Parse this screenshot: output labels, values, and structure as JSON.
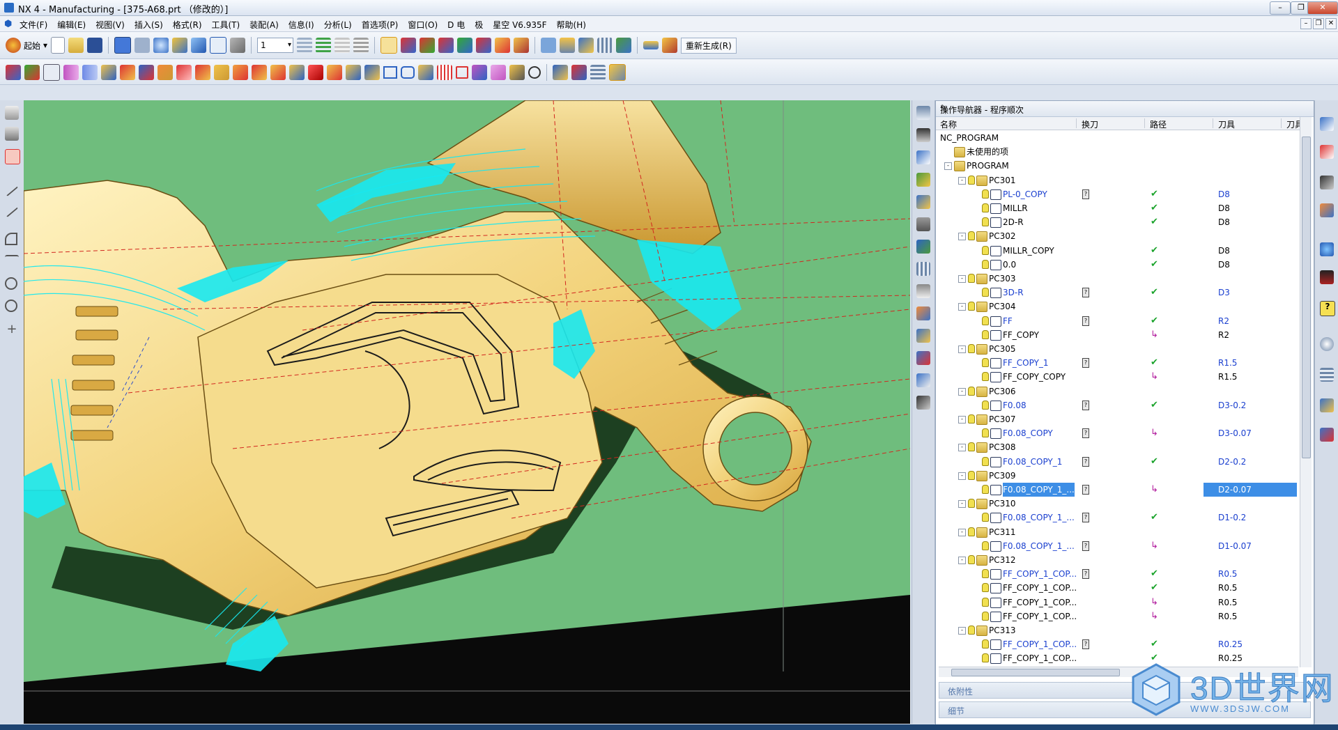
{
  "window": {
    "title": "NX 4 - Manufacturing - [375-A68.prt （修改的）]",
    "controls": {
      "minimize": "–",
      "restore": "❐",
      "close": "✕"
    }
  },
  "menubar": {
    "items": [
      "文件(F)",
      "编辑(E)",
      "视图(V)",
      "插入(S)",
      "格式(R)",
      "工具(T)",
      "装配(A)",
      "信息(I)",
      "分析(L)",
      "首选项(P)",
      "窗口(O)",
      "D 电",
      "极",
      "星空 V6.935F",
      "帮助(H)"
    ]
  },
  "toolbar": {
    "start_label": "起始",
    "layer_value": "1",
    "regen_label": "重新生成(R)"
  },
  "navigator": {
    "title": "操作导航器 - 程序顺次",
    "columns": [
      "名称",
      "换刀",
      "路径",
      "刀具",
      "刀具"
    ],
    "rows": [
      {
        "level": 0,
        "name": "NC_PROGRAM",
        "kind": "root"
      },
      {
        "level": 1,
        "name": "未使用的项",
        "kind": "folder"
      },
      {
        "level": 1,
        "name": "PROGRAM",
        "kind": "folder",
        "expand": "-"
      },
      {
        "level": 2,
        "name": "PC301",
        "kind": "folder",
        "expand": "-"
      },
      {
        "level": 3,
        "name": "PL-0_COPY",
        "kind": "op",
        "blue": true,
        "tc": true,
        "path": "ok",
        "tool": "D8",
        "toolBlue": true
      },
      {
        "level": 3,
        "name": "MILLR",
        "kind": "op",
        "path": "ok",
        "tool": "D8"
      },
      {
        "level": 3,
        "name": "2D-R",
        "kind": "op",
        "path": "ok",
        "tool": "D8"
      },
      {
        "level": 2,
        "name": "PC302",
        "kind": "folder",
        "expand": "-"
      },
      {
        "level": 3,
        "name": "MILLR_COPY",
        "kind": "op",
        "path": "ok",
        "tool": "D8"
      },
      {
        "level": 3,
        "name": "0.0",
        "kind": "op",
        "path": "ok",
        "tool": "D8"
      },
      {
        "level": 2,
        "name": "PC303",
        "kind": "folder",
        "expand": "-"
      },
      {
        "level": 3,
        "name": "3D-R",
        "kind": "op",
        "blue": true,
        "tc": true,
        "path": "ok",
        "tool": "D3",
        "toolBlue": true
      },
      {
        "level": 2,
        "name": "PC304",
        "kind": "folder",
        "expand": "-"
      },
      {
        "level": 3,
        "name": "FF",
        "kind": "op",
        "blue": true,
        "tc": true,
        "path": "ok",
        "tool": "R2",
        "toolBlue": true
      },
      {
        "level": 3,
        "name": "FF_COPY",
        "kind": "op",
        "path": "rep",
        "tool": "R2"
      },
      {
        "level": 2,
        "name": "PC305",
        "kind": "folder",
        "expand": "-"
      },
      {
        "level": 3,
        "name": "FF_COPY_1",
        "kind": "op",
        "blue": true,
        "tc": true,
        "path": "ok",
        "tool": "R1.5",
        "toolBlue": true
      },
      {
        "level": 3,
        "name": "FF_COPY_COPY",
        "kind": "op",
        "path": "rep",
        "tool": "R1.5"
      },
      {
        "level": 2,
        "name": "PC306",
        "kind": "folder",
        "expand": "-"
      },
      {
        "level": 3,
        "name": "F0.08",
        "kind": "op",
        "blue": true,
        "tc": true,
        "path": "ok",
        "tool": "D3-0.2",
        "toolBlue": true
      },
      {
        "level": 2,
        "name": "PC307",
        "kind": "folder",
        "expand": "-"
      },
      {
        "level": 3,
        "name": "F0.08_COPY",
        "kind": "op",
        "blue": true,
        "tc": true,
        "path": "rep",
        "tool": "D3-0.07",
        "toolBlue": true
      },
      {
        "level": 2,
        "name": "PC308",
        "kind": "folder",
        "expand": "-"
      },
      {
        "level": 3,
        "name": "F0.08_COPY_1",
        "kind": "op",
        "blue": true,
        "tc": true,
        "path": "ok",
        "tool": "D2-0.2",
        "toolBlue": true
      },
      {
        "level": 2,
        "name": "PC309",
        "kind": "folder",
        "expand": "-"
      },
      {
        "level": 3,
        "name": "F0.08_COPY_1_...",
        "kind": "op",
        "blue": true,
        "tc": true,
        "path": "rep",
        "tool": "D2-0.07",
        "selected": true
      },
      {
        "level": 2,
        "name": "PC310",
        "kind": "folder",
        "expand": "-"
      },
      {
        "level": 3,
        "name": "F0.08_COPY_1_...",
        "kind": "op",
        "blue": true,
        "tc": true,
        "path": "ok",
        "tool": "D1-0.2",
        "toolBlue": true
      },
      {
        "level": 2,
        "name": "PC311",
        "kind": "folder",
        "expand": "-"
      },
      {
        "level": 3,
        "name": "F0.08_COPY_1_...",
        "kind": "op",
        "blue": true,
        "tc": true,
        "path": "rep",
        "tool": "D1-0.07",
        "toolBlue": true
      },
      {
        "level": 2,
        "name": "PC312",
        "kind": "folder",
        "expand": "-"
      },
      {
        "level": 3,
        "name": "FF_COPY_1_COP...",
        "kind": "op",
        "blue": true,
        "tc": true,
        "path": "ok",
        "tool": "R0.5",
        "toolBlue": true
      },
      {
        "level": 3,
        "name": "FF_COPY_1_COP...",
        "kind": "op",
        "path": "ok",
        "tool": "R0.5"
      },
      {
        "level": 3,
        "name": "FF_COPY_1_COP...",
        "kind": "op",
        "path": "rep",
        "tool": "R0.5"
      },
      {
        "level": 3,
        "name": "FF_COPY_1_COP...",
        "kind": "op",
        "path": "rep",
        "tool": "R0.5"
      },
      {
        "level": 2,
        "name": "PC313",
        "kind": "folder",
        "expand": "-"
      },
      {
        "level": 3,
        "name": "FF_COPY_1_COP...",
        "kind": "op",
        "blue": true,
        "tc": true,
        "path": "ok",
        "tool": "R0.25",
        "toolBlue": true
      },
      {
        "level": 3,
        "name": "FF_COPY_1_COP...",
        "kind": "op",
        "path": "ok",
        "tool": "R0.25"
      }
    ],
    "symbols": {
      "ok": "✔",
      "rep": "↳",
      "tc": "?"
    },
    "panels": [
      "依附性",
      "细节"
    ]
  },
  "watermark": {
    "text": "3D世界网",
    "url": "WWW.3DSJW.COM"
  },
  "colors": {
    "viewport_bg": "#6fbd7d",
    "part": "#f2d27a",
    "toolpath": "#18e8f0",
    "selection": "#3d8ee6"
  }
}
